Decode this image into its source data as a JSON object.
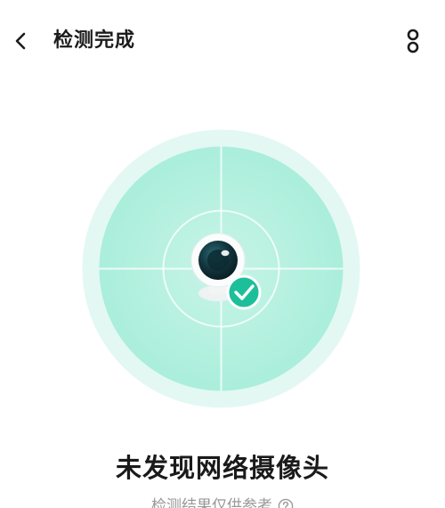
{
  "header": {
    "title": "检测完成",
    "back_icon": "chevron-left-icon",
    "more_icon": "more-vertical-icon"
  },
  "illustration": {
    "icon": "camera-icon",
    "status_icon": "check-icon",
    "colors": {
      "outer_ring": "#e3f8f3",
      "inner_disc": "#b9efdf",
      "accent": "#1dbf9a"
    }
  },
  "result": {
    "title": "未发现网络摄像头",
    "note": "检测结果仅供参考",
    "help_icon": "question-circle-icon"
  }
}
